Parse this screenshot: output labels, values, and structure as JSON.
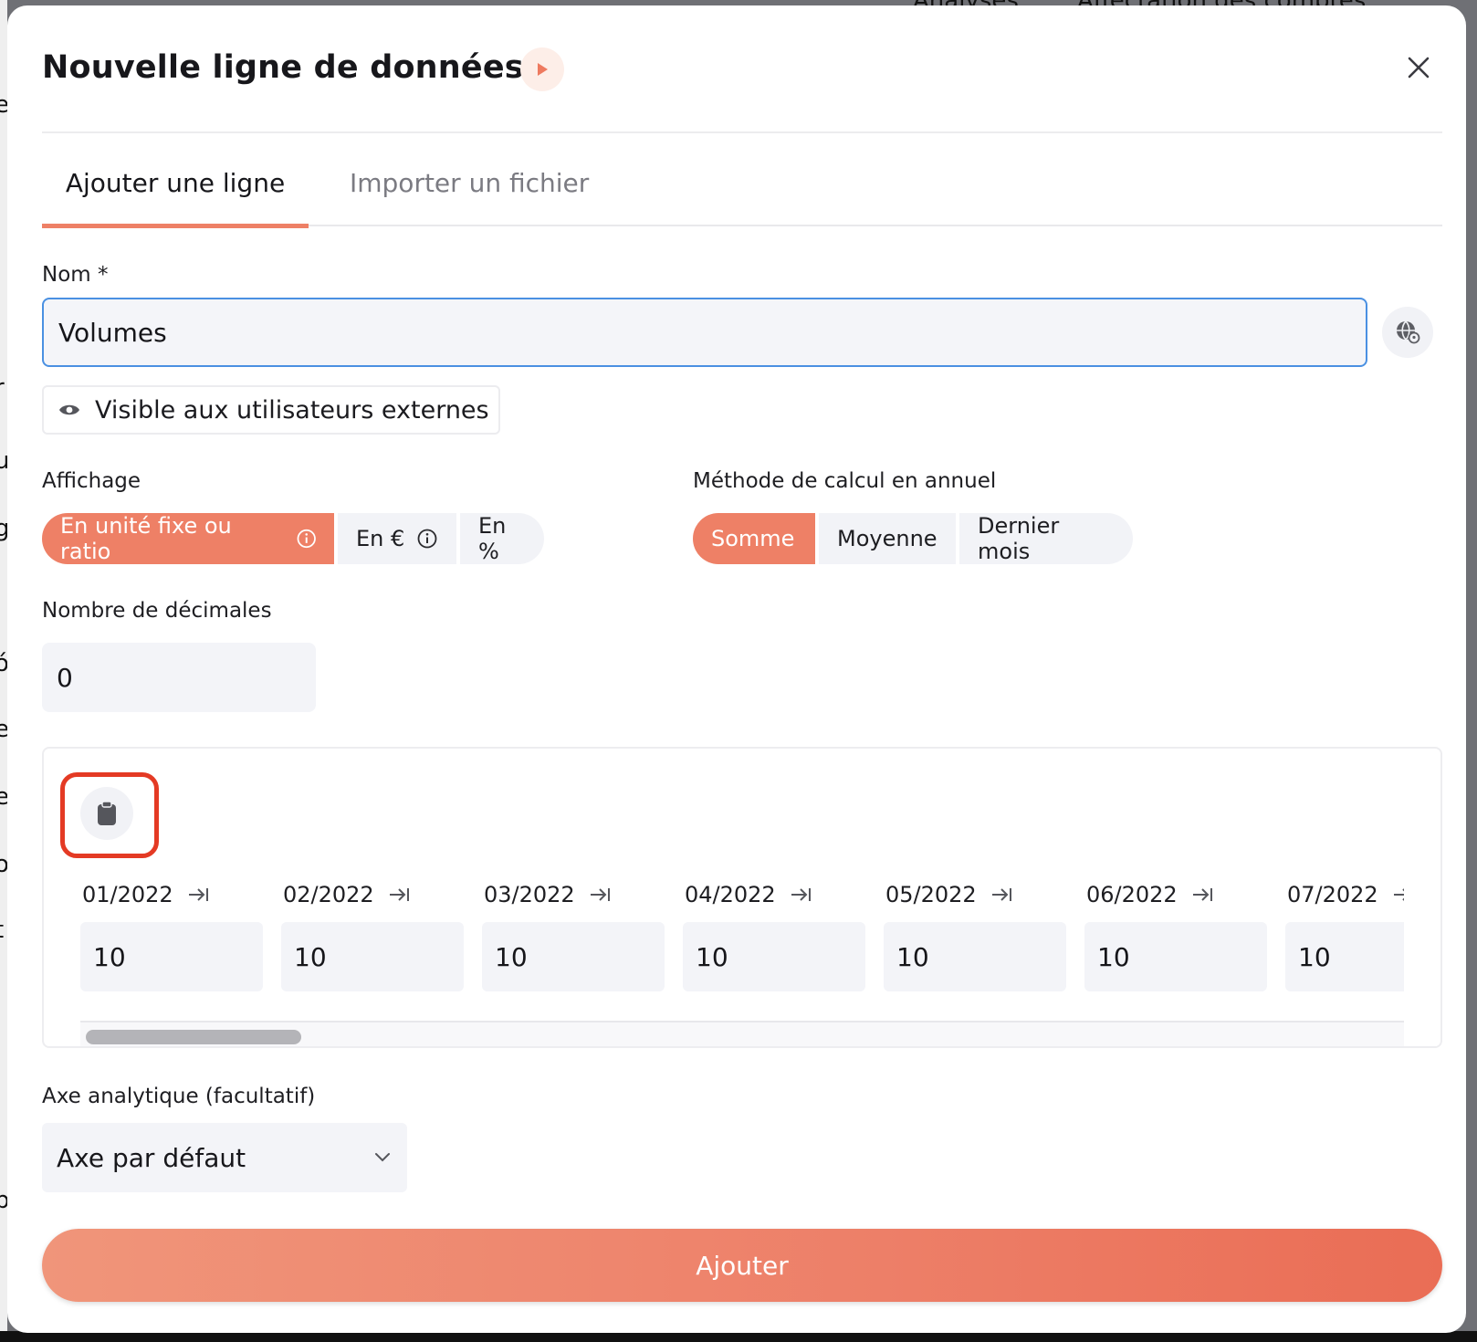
{
  "background": {
    "topnav": [
      "Analyses",
      "Affectation des comptes"
    ]
  },
  "modal": {
    "title": "Nouvelle ligne de données",
    "tabs": [
      {
        "label": "Ajouter une ligne",
        "active": true
      },
      {
        "label": "Importer un fichier",
        "active": false
      }
    ],
    "name": {
      "label": "Nom *",
      "value": "Volumes"
    },
    "visibility": {
      "label": "Visible aux utilisateurs externes"
    },
    "affichage": {
      "label": "Affichage",
      "options": [
        "En unité fixe ou ratio",
        "En €",
        "En %"
      ],
      "selected": "En unité fixe ou ratio"
    },
    "methode": {
      "label": "Méthode de calcul en annuel",
      "options": [
        "Somme",
        "Moyenne",
        "Dernier mois"
      ],
      "selected": "Somme"
    },
    "decimales": {
      "label": "Nombre de décimales",
      "value": "0"
    },
    "months": [
      {
        "label": "01/2022",
        "value": "10"
      },
      {
        "label": "02/2022",
        "value": "10"
      },
      {
        "label": "03/2022",
        "value": "10"
      },
      {
        "label": "04/2022",
        "value": "10"
      },
      {
        "label": "05/2022",
        "value": "10"
      },
      {
        "label": "06/2022",
        "value": "10"
      },
      {
        "label": "07/2022",
        "value": "10"
      }
    ],
    "axe": {
      "label": "Axe analytique (facultatif)",
      "value": "Axe par défaut"
    },
    "submit_label": "Ajouter"
  },
  "colors": {
    "accent": "#ee8066",
    "focus": "#4a90e2",
    "highlight": "#e43a24"
  }
}
